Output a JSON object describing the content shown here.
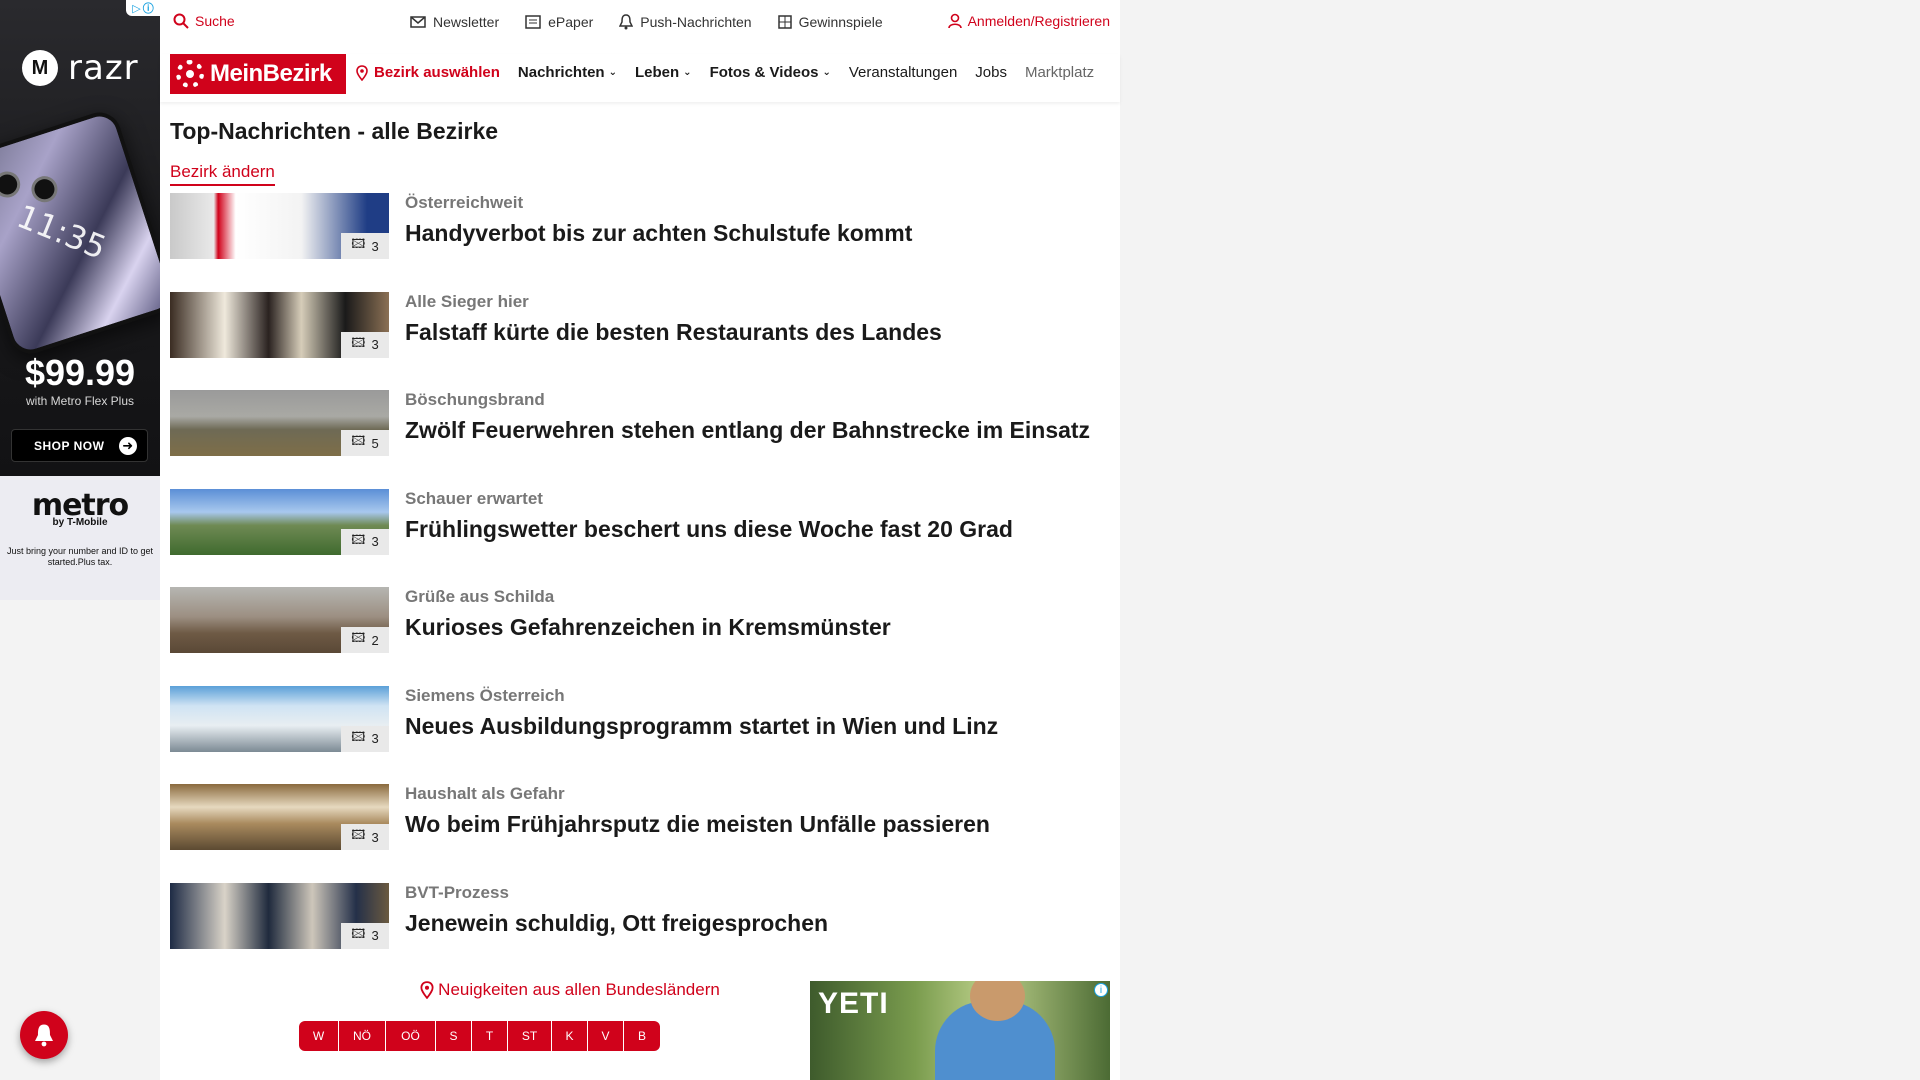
{
  "topbar": {
    "search": "Suche",
    "newsletter": "Newsletter",
    "epaper": "ePaper",
    "push": "Push-Nachrichten",
    "gewinnspiele": "Gewinnspiele",
    "login": "Anmelden/Registrieren"
  },
  "nav": {
    "logo": "MeinBezirk",
    "bezirk": "Bezirk auswählen",
    "items": [
      "Nachrichten",
      "Leben",
      "Fotos & Videos",
      "Veranstaltungen",
      "Jobs",
      "Marktplatz"
    ]
  },
  "section": {
    "title": "Top-Nachrichten - alle Bezirke",
    "change": "Bezirk ändern"
  },
  "articles": [
    {
      "category": "Österreichweit",
      "headline": "Handyverbot bis zur achten Schulstufe kommt",
      "images": "3"
    },
    {
      "category": "Alle Sieger hier",
      "headline": "Falstaff kürte die besten Restaurants des Landes",
      "images": "3"
    },
    {
      "category": "Böschungsbrand",
      "headline": "Zwölf Feuerwehren stehen entlang der Bahnstrecke im Einsatz",
      "images": "5"
    },
    {
      "category": "Schauer erwartet",
      "headline": "Frühlingswetter beschert uns diese Woche fast 20 Grad",
      "images": "3"
    },
    {
      "category": "Grüße aus Schilda",
      "headline": "Kurioses Gefahrenzeichen in Kremsmünster",
      "images": "2"
    },
    {
      "category": "Siemens Österreich",
      "headline": "Neues Ausbildungsprogramm startet in Wien und Linz",
      "images": "3"
    },
    {
      "category": "Haushalt als Gefahr",
      "headline": "Wo beim Frühjahrsputz die meisten Unfälle passieren",
      "images": "3"
    },
    {
      "category": "BVT-Prozess",
      "headline": "Jenewein schuldig, Ott freigesprochen",
      "images": "3"
    }
  ],
  "bundeslaender": {
    "title": "Neuigkeiten aus allen Bundesländern",
    "states": [
      "W",
      "NÖ",
      "OÖ",
      "S",
      "T",
      "ST",
      "K",
      "V",
      "B"
    ]
  },
  "ad_left": {
    "brand": "razr",
    "clock": "11:35",
    "price": "$99.99",
    "price_sub": "with Metro Flex Plus",
    "cta": "SHOP NOW",
    "metro": "metro",
    "metro_sub": "by T-Mobile",
    "note": "Just bring your number and ID to get started.Plus tax."
  },
  "ad_bottom": {
    "brand": "YETI"
  },
  "colors": {
    "brand_red": "#d0021b"
  }
}
